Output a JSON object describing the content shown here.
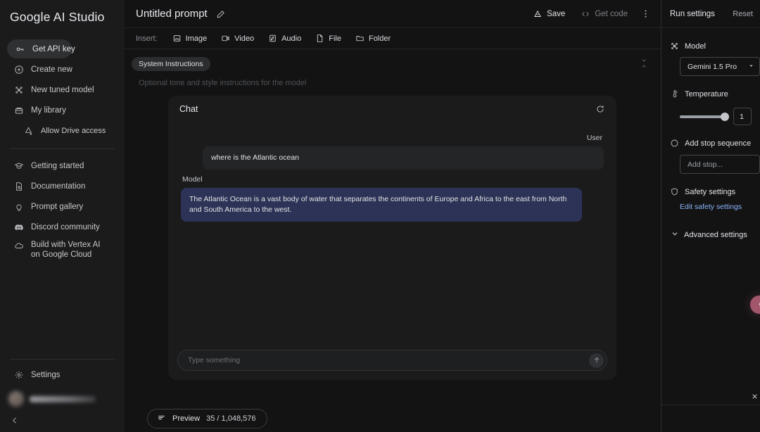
{
  "sidebar": {
    "brand": "Google AI Studio",
    "primary": [
      {
        "label": "Get API key",
        "icon": "key-icon"
      },
      {
        "label": "Create new",
        "icon": "plus-circle-icon"
      },
      {
        "label": "New tuned model",
        "icon": "tune-model-icon"
      },
      {
        "label": "My library",
        "icon": "library-icon"
      },
      {
        "label": "Allow Drive access",
        "icon": "drive-access-icon"
      }
    ],
    "secondary": [
      {
        "label": "Getting started",
        "icon": "graduation-cap-icon"
      },
      {
        "label": "Documentation",
        "icon": "document-search-icon"
      },
      {
        "label": "Prompt gallery",
        "icon": "lightbulb-icon"
      },
      {
        "label": "Discord community",
        "icon": "discord-icon"
      },
      {
        "label": "Build with Vertex AI on Google Cloud",
        "icon": "cloud-icon"
      }
    ],
    "settings": {
      "label": "Settings",
      "icon": "gear-icon"
    }
  },
  "topbar": {
    "prompt_title": "Untitled prompt",
    "edit_icon": "pencil-icon",
    "save_label": "Save",
    "save_icon": "drive-icon",
    "get_code_label": "Get code",
    "get_code_icon": "code-brackets-icon",
    "menu_icon": "more-vert-icon"
  },
  "insert": {
    "label": "Insert:",
    "items": [
      {
        "label": "Image",
        "icon": "image-icon"
      },
      {
        "label": "Video",
        "icon": "video-icon"
      },
      {
        "label": "Audio",
        "icon": "audio-icon"
      },
      {
        "label": "File",
        "icon": "file-icon"
      },
      {
        "label": "Folder",
        "icon": "folder-icon"
      }
    ]
  },
  "system_instructions": {
    "chip_label": "System Instructions",
    "placeholder": "Optional tone and style instructions for the model",
    "collapse_icon": "collapse-chevrons-icon"
  },
  "chat": {
    "title": "Chat",
    "refresh_icon": "refresh-icon",
    "messages": [
      {
        "role": "User",
        "text": "where is the Atlantic ocean"
      },
      {
        "role": "Model",
        "text": "The Atlantic Ocean is a vast body of water that separates the continents of Europe and Africa to the east from North and South America to the west."
      }
    ],
    "input_placeholder": "Type something",
    "input_value": "",
    "send_icon": "send-icon"
  },
  "bottombar": {
    "preview_label": "Preview",
    "preview_icon": "tokens-icon",
    "token_count": "35 / 1,048,576"
  },
  "run_settings": {
    "title": "Run settings",
    "reset_label": "Reset",
    "model": {
      "label": "Model",
      "icon": "tune-model-icon",
      "selected": "Gemini 1.5 Pro",
      "caret_icon": "chevron-down-icon"
    },
    "temperature": {
      "label": "Temperature",
      "icon": "thermometer-icon",
      "value": "1",
      "min": 0,
      "max": 1
    },
    "stop_sequence": {
      "label": "Add stop sequence",
      "icon": "stop-hexagon-icon",
      "placeholder": "Add stop..."
    },
    "safety": {
      "label": "Safety settings",
      "icon": "shield-icon",
      "link_label": "Edit safety settings"
    },
    "advanced": {
      "label": "Advanced settings",
      "icon": "chevron-down-icon"
    },
    "fab_icon": "feedback-icon",
    "close_icon": "close-icon"
  },
  "colors": {
    "page_bg": "#131314",
    "panel_bg": "#1b1b1c",
    "model_bubble": "#2c3357",
    "user_bubble": "#242527",
    "link": "#8ab4f8",
    "fab": "#a2566c"
  }
}
